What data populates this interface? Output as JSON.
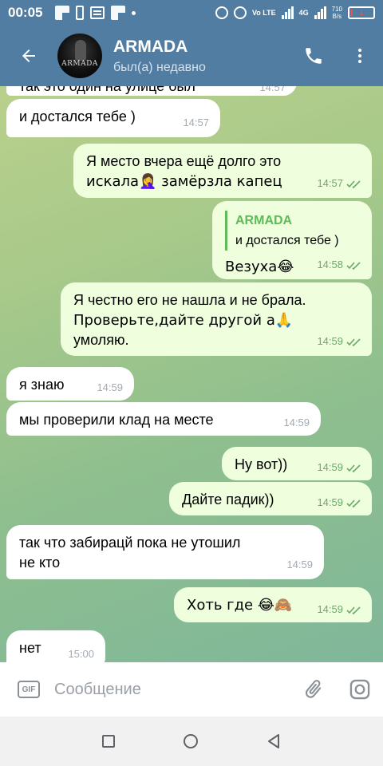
{
  "status_bar": {
    "time": "00:05",
    "lte": "Vo LTE",
    "net": "4G",
    "speed_value": "710",
    "speed_unit": "B/s",
    "battery": "1"
  },
  "header": {
    "title": "ARMADA",
    "subtitle": "был(а) недавно",
    "avatar_text": "ARMADA"
  },
  "messages": [
    {
      "id": "m0",
      "dir": "in",
      "text": "так это один на улице был",
      "time": "14:57"
    },
    {
      "id": "m1",
      "dir": "in",
      "text": "и достался тебе )",
      "time": "14:57"
    },
    {
      "id": "m2",
      "dir": "out",
      "line1": "Я место вчера ещё долго это",
      "line2": "искала🤦‍♀️ замёрзла капец",
      "time": "14:57"
    },
    {
      "id": "m3",
      "dir": "out",
      "reply_name": "ARMADA",
      "reply_text": "и достался тебе )",
      "text": "Везуха😂",
      "time": "14:58"
    },
    {
      "id": "m4",
      "dir": "out",
      "line1": "Я честно его не нашла и не брала.",
      "line2": "Проверьте,дайте другой а🙏",
      "line3": "умоляю.",
      "time": "14:59"
    },
    {
      "id": "m5",
      "dir": "in",
      "text": "я знаю",
      "time": "14:59"
    },
    {
      "id": "m6",
      "dir": "in",
      "text": "мы проверили клад на месте",
      "time": "14:59"
    },
    {
      "id": "m7",
      "dir": "out",
      "text": "Ну вот))",
      "time": "14:59"
    },
    {
      "id": "m8",
      "dir": "out",
      "text": "Дайте падик))",
      "time": "14:59"
    },
    {
      "id": "m9",
      "dir": "in",
      "line1": "так  что забирацй  пока не утошил",
      "line2": "не кто",
      "time": "14:59"
    },
    {
      "id": "m10",
      "dir": "out",
      "text": "Хоть где 😂🙈",
      "time": "14:59"
    },
    {
      "id": "m11",
      "dir": "in",
      "text": "нет",
      "time": "15:00"
    }
  ],
  "input": {
    "placeholder": "Сообщение",
    "gif_label": "GIF"
  },
  "icons": {
    "back": "arrow-left-icon",
    "call": "phone-icon",
    "menu": "more-vertical-icon",
    "attach": "paperclip-icon",
    "camera": "instagram-camera-icon"
  },
  "colors": {
    "header": "#517da2",
    "bubble_in": "#ffffff",
    "bubble_out": "#effedd",
    "meta_out": "#6ba86a",
    "reply_accent": "#5fbb57"
  }
}
